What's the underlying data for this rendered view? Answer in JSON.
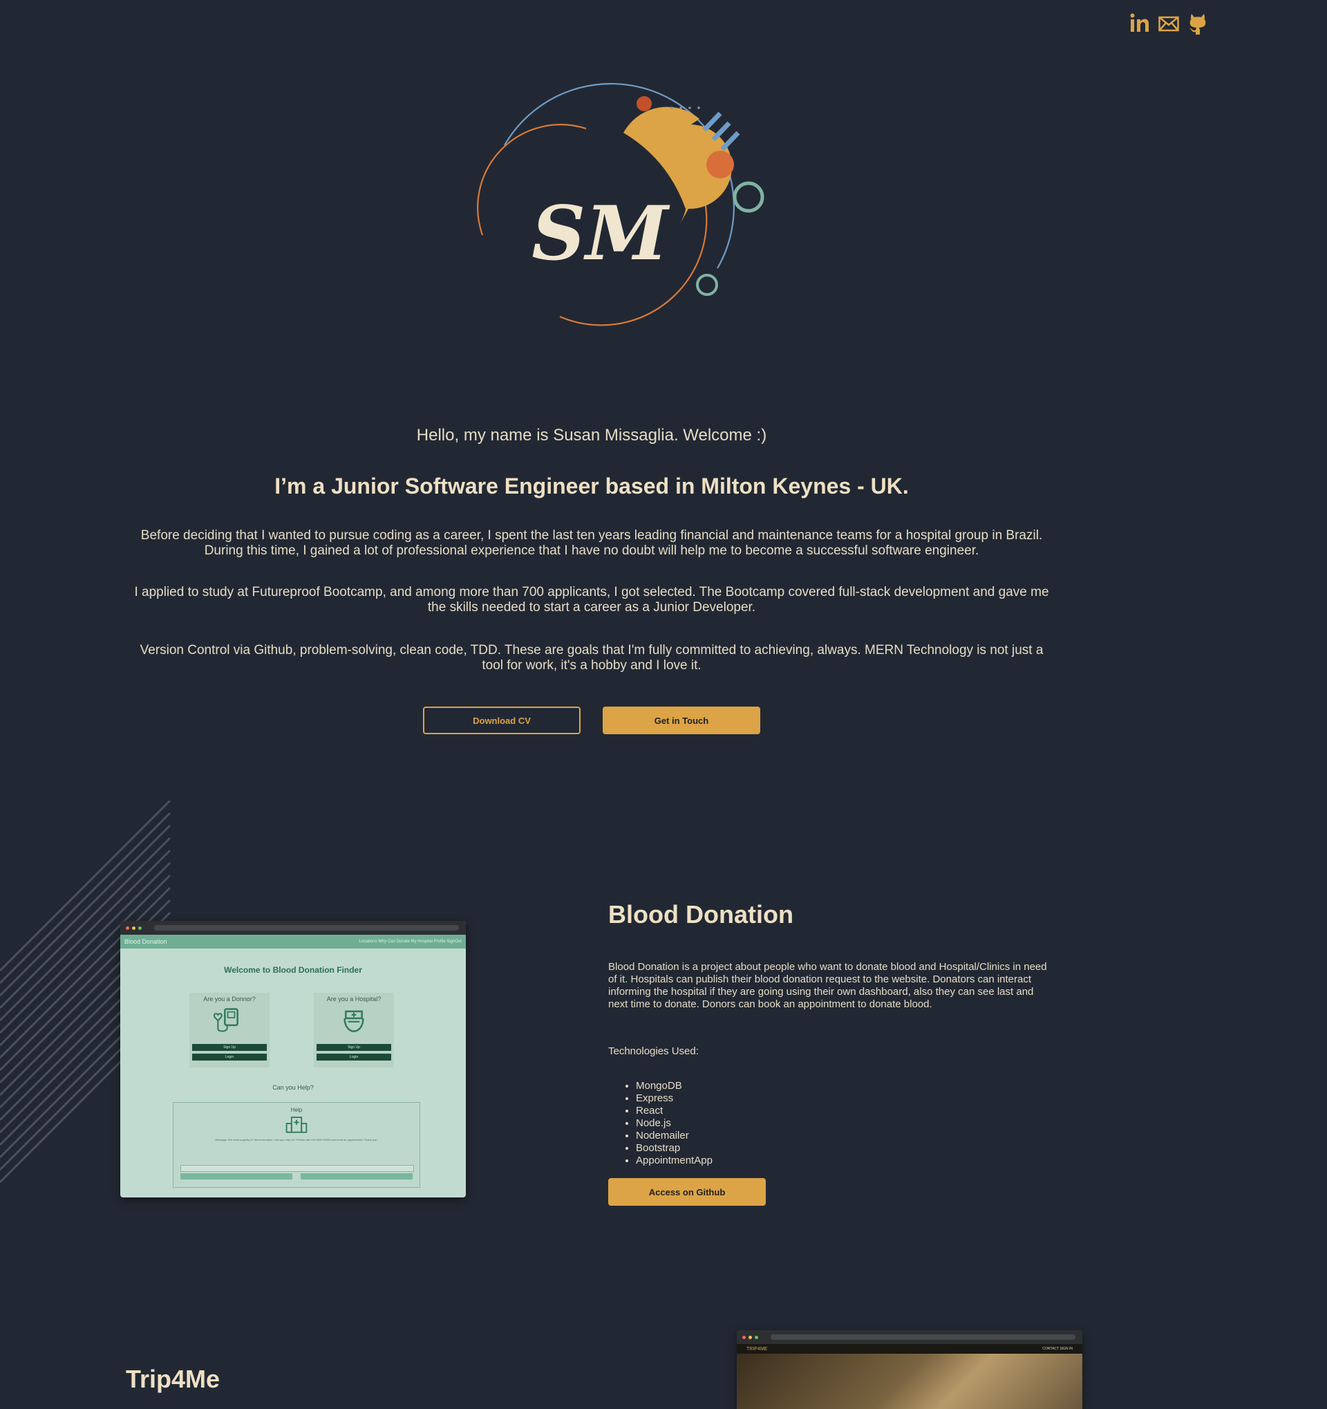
{
  "social": {
    "icons": [
      "linkedin-icon",
      "mail-icon",
      "github-icon"
    ],
    "accent": "#dca446"
  },
  "logo": {
    "monogram": "SM"
  },
  "hero": {
    "greeting": "Hello, my name is Susan Missaglia. Welcome :)",
    "headline": "I’m a Junior Software Engineer based in Milton Keynes - UK.",
    "paragraphs": [
      "Before deciding that I wanted to pursue coding as a career, I spent the last ten years leading financial and maintenance teams for a hospital group in Brazil. During this time, I gained a lot of professional experience that I have no doubt will help me to become a successful software engineer.",
      "I applied to study at Futureproof Bootcamp, and among more than 700 applicants, I got selected. The Bootcamp covered full-stack development and gave me the skills needed to start a career as a Junior Developer.",
      "Version Control via Github, problem-solving, clean code, TDD. These are goals that I'm fully committed to achieving, always. MERN Technology is not just a tool for work, it's a hobby and I love it."
    ],
    "download_cv": "Download CV",
    "get_in_touch": "Get in Touch"
  },
  "projects": [
    {
      "title": "Blood Donation",
      "description": "Blood Donation is a project about people who want to donate blood and Hospital/Clinics in need of it. Hospitals can publish their blood donation request to the website. Donators can interact informing the hospital if they are going using their own dashboard, also they can see last and next time to donate. Donors can book an appointment to donate blood.",
      "tech_label": "Technologies Used:",
      "technologies": [
        "MongoDB",
        "Express",
        "React",
        "Node.js",
        "Nodemailer",
        "Bootstrap",
        "AppointmentApp"
      ],
      "button": "Access on Github",
      "screenshot": {
        "app_name": "Blood Donation",
        "nav_links": "Locations   Why Can Donate   My Hospital Profile   SignOut",
        "welcome": "Welcome to Blood Donation Finder",
        "donor_q": "Are you a Donnor?",
        "hospital_q": "Are you a Hospital?",
        "sign_up": "Sign Up",
        "login": "Login",
        "can_help": "Can you Help?",
        "help": "Help",
        "message": "Message: We need urgently 0+ blood donation. Can you help us? Please call +00 0000 00000 and book an appointment. Thank you."
      }
    },
    {
      "title": "Trip4Me",
      "screenshot": {
        "brand": "TRIP4ME",
        "nav_links": "CONTACT   SIGN IN"
      }
    }
  ],
  "colors": {
    "background": "#222833",
    "accent": "#dca446",
    "text": "#ebe2cf"
  }
}
